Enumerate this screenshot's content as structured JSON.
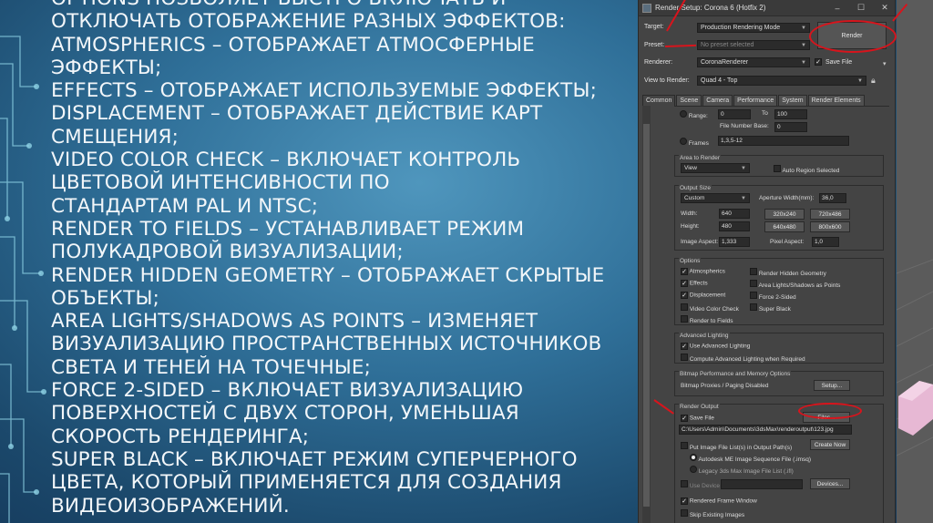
{
  "slide": {
    "lines": [
      "OPTIONS позволяет быстро включать и",
      "отключать отображение разных эффектов:",
      "Atmospherics – отображает атмосферные",
      "эффекты;",
      "Effects – отображает используемые эффекты;",
      "Displacement – отображает действие карт",
      "смещения;",
      "Video Color Check – включает контроль",
      "цветовой интенсивности по",
      "стандартам PAL и NTSC;",
      "Render to Fields – устанавливает режим",
      "полукадровой визуализации;",
      "Render Hidden Geometry – отображает скрытые",
      "объекты;",
      "Area Lights/Shadows as Points – изменяет",
      "визуализацию пространственных источников",
      "света и теней на точечные;",
      "Force 2-Sided – включает визуализацию",
      "поверхностей с двух сторон, уменьшая",
      "скорость рендеринга;",
      "Super Black – включает режим суперчерного",
      "цвета, который применяется для создания",
      "видеоизображений."
    ]
  },
  "window": {
    "title": "Render Setup: Corona 6 (Hotfix 2)",
    "minimize": "–",
    "restore": "☐",
    "close": "✕"
  },
  "top": {
    "target_label": "Target:",
    "target_value": "Production Rendering Mode",
    "preset_label": "Preset:",
    "preset_value": "No preset selected",
    "renderer_label": "Renderer:",
    "renderer_value": "CoronaRenderer",
    "save_file_label": "Save File",
    "view_label": "View to Render:",
    "view_value": "Quad 4 - Top",
    "render_button": "Render"
  },
  "tabs": [
    "Common",
    "Scene",
    "Camera",
    "Performance",
    "System",
    "Render Elements"
  ],
  "time": {
    "range_label": "Range:",
    "range_from": "0",
    "to_label": "To",
    "range_to": "100",
    "fnb_label": "File Number Base:",
    "fnb_value": "0",
    "frames_label": "Frames",
    "frames_value": "1,3,5-12"
  },
  "area": {
    "title": "Area to Render",
    "value": "View",
    "auto_region": "Auto Region Selected"
  },
  "output": {
    "title": "Output Size",
    "preset": "Custom",
    "aperture_label": "Aperture Width(mm):",
    "aperture_value": "36,0",
    "width_label": "Width:",
    "width_value": "640",
    "height_label": "Height:",
    "height_value": "480",
    "presets": [
      "320x240",
      "720x486",
      "640x480",
      "800x600"
    ],
    "aspect_label": "Image Aspect:",
    "aspect_value": "1,333",
    "pixel_label": "Pixel Aspect:",
    "pixel_value": "1,0"
  },
  "options": {
    "title": "Options",
    "atmospherics": "Atmospherics",
    "effects": "Effects",
    "displacement": "Displacement",
    "video": "Video Color Check",
    "fields": "Render to Fields",
    "hidden": "Render Hidden Geometry",
    "area_lights": "Area Lights/Shadows as Points",
    "force2": "Force 2-Sided",
    "superblack": "Super Black"
  },
  "adv": {
    "title": "Advanced Lighting",
    "use": "Use Advanced Lighting",
    "compute": "Compute Advanced Lighting when Required"
  },
  "bitmap": {
    "title": "Bitmap Performance and Memory Options",
    "proxies": "Bitmap Proxies / Paging Disabled",
    "setup": "Setup..."
  },
  "render_output": {
    "title": "Render Output",
    "save_file": "Save File",
    "files_button": "Files...",
    "path": "C:\\Users\\Admin\\Documents\\3dsMax\\renderoutput\\123.jpg",
    "put_image": "Put Image File List(s) in Output Path(s)",
    "create_now": "Create Now",
    "autodesk": "Autodesk ME Image Sequence File (.imsq)",
    "legacy": "Legacy 3ds Max Image File List (.ifl)",
    "use_device": "Use Device",
    "devices": "Devices...",
    "rendered_frame": "Rendered Frame Window",
    "skip": "Skip Existing Images"
  },
  "colors": {
    "annotation": "#d8141c",
    "bg": "#2f6f98",
    "panel": "#444444"
  }
}
